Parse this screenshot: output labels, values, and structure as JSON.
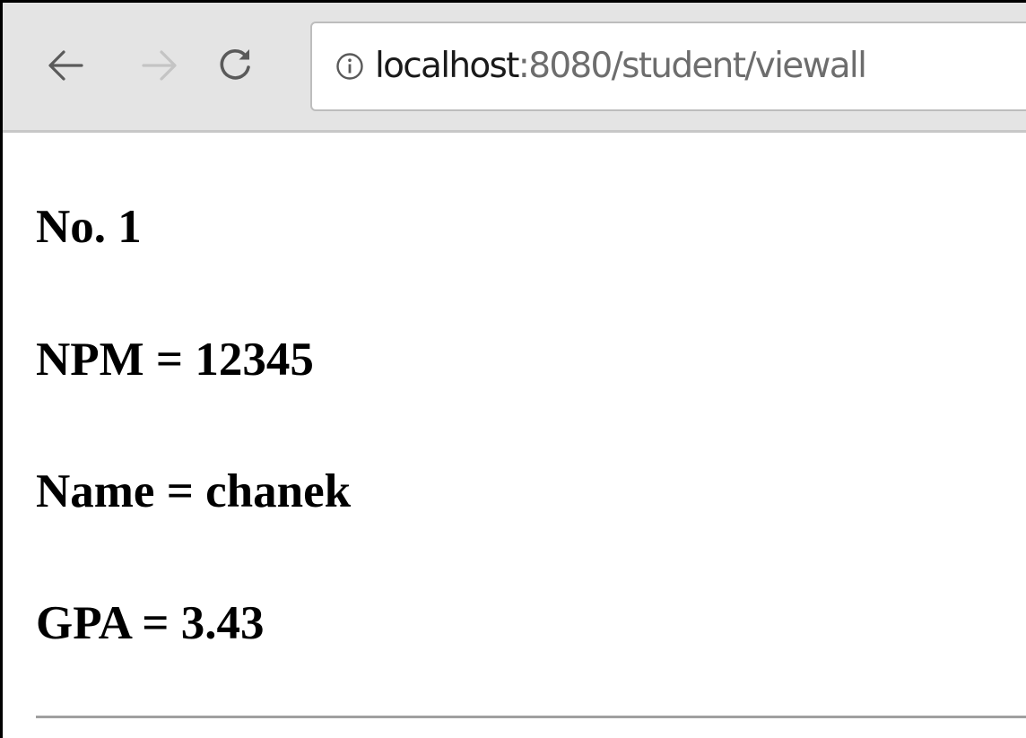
{
  "browser": {
    "url_host": "localhost",
    "url_path": ":8080/student/viewall",
    "icons": {
      "back": "arrow-left-icon",
      "forward": "arrow-right-icon",
      "reload": "reload-icon",
      "site_info": "info-circle-icon"
    }
  },
  "student": {
    "number": "No. 1",
    "npm": "NPM = 12345",
    "name": "Name = chanek",
    "gpa": "GPA = 3.43"
  },
  "colors": {
    "toolbar_bg": "#e4e4e4",
    "url_path": "#6d6d6d",
    "forward_disabled": "#c4c4c4",
    "rule": "#a0a0a0"
  }
}
